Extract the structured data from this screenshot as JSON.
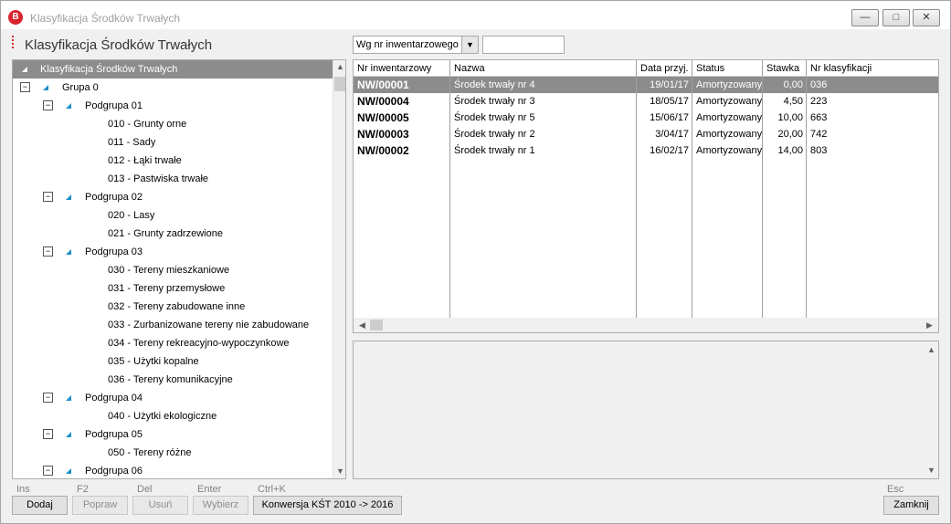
{
  "window": {
    "title": "Klasyfikacja Środków Trwałych",
    "app_icon_letter": "B"
  },
  "header": {
    "title": "Klasyfikacja Środków Trwałych",
    "sort_value": "Wg nr inwentarzowego",
    "search_value": ""
  },
  "tree": {
    "root": "Klasyfikacja Środków Trwałych",
    "rows": [
      {
        "level": 0,
        "label": "Grupa 0"
      },
      {
        "level": 1,
        "label": "Podgrupa 01"
      },
      {
        "level": 2,
        "label": "010 - Grunty orne"
      },
      {
        "level": 2,
        "label": "011 - Sady"
      },
      {
        "level": 2,
        "label": "012 - Łąki trwałe"
      },
      {
        "level": 2,
        "label": "013 - Pastwiska trwałe"
      },
      {
        "level": 1,
        "label": "Podgrupa 02"
      },
      {
        "level": 2,
        "label": "020 - Lasy"
      },
      {
        "level": 2,
        "label": "021 - Grunty zadrzewione"
      },
      {
        "level": 1,
        "label": "Podgrupa 03"
      },
      {
        "level": 2,
        "label": "030 - Tereny mieszkaniowe"
      },
      {
        "level": 2,
        "label": "031 - Tereny przemysłowe"
      },
      {
        "level": 2,
        "label": "032 - Tereny zabudowane inne"
      },
      {
        "level": 2,
        "label": "033 - Zurbanizowane tereny nie zabudowane"
      },
      {
        "level": 2,
        "label": "034 - Tereny rekreacyjno-wypoczynkowe"
      },
      {
        "level": 2,
        "label": "035 - Użytki kopalne"
      },
      {
        "level": 2,
        "label": "036 - Tereny komunikacyjne"
      },
      {
        "level": 1,
        "label": "Podgrupa 04"
      },
      {
        "level": 2,
        "label": "040 - Użytki ekologiczne"
      },
      {
        "level": 1,
        "label": "Podgrupa 05"
      },
      {
        "level": 2,
        "label": "050 - Tereny różne"
      },
      {
        "level": 1,
        "label": "Podgrupa 06"
      }
    ]
  },
  "grid": {
    "columns": [
      "Nr inwentarzowy",
      "Nazwa",
      "Data przyj.",
      "Status",
      "Stawka",
      "Nr klasyfikacji"
    ],
    "rows": [
      [
        "NW/00001",
        "Środek trwały nr 4",
        "19/01/17",
        "Amortyzowany",
        "0,00",
        "036"
      ],
      [
        "NW/00004",
        "Środek trwały nr 3",
        "18/05/17",
        "Amortyzowany",
        "4,50",
        "223"
      ],
      [
        "NW/00005",
        "Środek trwały nr 5",
        "15/06/17",
        "Amortyzowany",
        "10,00",
        "663"
      ],
      [
        "NW/00003",
        "Środek trwały nr 2",
        "3/04/17",
        "Amortyzowany",
        "20,00",
        "742"
      ],
      [
        "NW/00002",
        "Środek trwały nr 1",
        "16/02/17",
        "Amortyzowany",
        "14,00",
        "803"
      ]
    ],
    "selected_row": 0
  },
  "buttons": {
    "add": {
      "key": "Ins",
      "label": "Dodaj"
    },
    "edit": {
      "key": "F2",
      "label": "Popraw"
    },
    "delete": {
      "key": "Del",
      "label": "Usuń"
    },
    "select": {
      "key": "Enter",
      "label": "Wybierz"
    },
    "convert": {
      "key": "Ctrl+K",
      "label": "Konwersja KŚT 2010 -> 2016"
    },
    "close": {
      "key": "Esc",
      "label": "Zamknij"
    }
  },
  "colors": {
    "selection": "#8c8c8c",
    "tree_triangle": "#1b8fc9",
    "app_red": "#d9232e"
  }
}
